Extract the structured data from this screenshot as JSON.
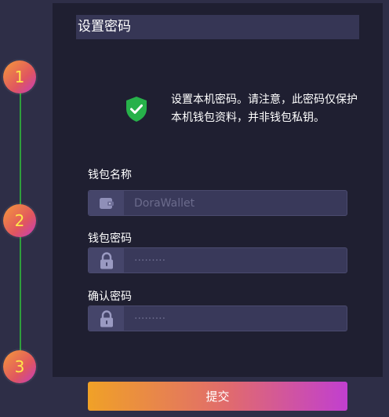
{
  "stepper": {
    "steps": [
      {
        "number": "1"
      },
      {
        "number": "2"
      },
      {
        "number": "3"
      }
    ],
    "line_color": "#2f9e3c",
    "accent_gradient": [
      "#f59a3a",
      "#c33dbd"
    ]
  },
  "card": {
    "title": "设置密码",
    "notice_icon": "shield-check-icon",
    "notice_icon_color": "#27b14a",
    "notice_line1": "设置本机密码。请注意，此密码仅保护",
    "notice_line2": "本机钱包资料，并非钱包私钥。"
  },
  "form": {
    "wallet_name": {
      "label": "钱包名称",
      "icon": "wallet-icon",
      "value": "",
      "placeholder": "DoraWallet"
    },
    "wallet_password": {
      "label": "钱包密码",
      "icon": "lock-icon",
      "value": "",
      "placeholder": "·········"
    },
    "confirm_password": {
      "label": "确认密码",
      "icon": "lock-icon",
      "value": "",
      "placeholder": "·········"
    }
  },
  "submit": {
    "label": "提交"
  }
}
